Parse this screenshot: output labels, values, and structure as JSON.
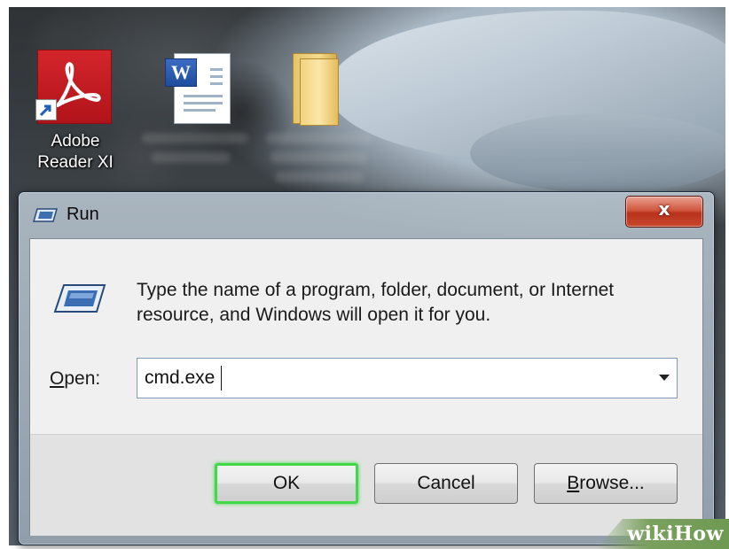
{
  "desktop": {
    "icons": [
      {
        "label": "Adobe\nReader XI"
      }
    ]
  },
  "run_dialog": {
    "title": "Run",
    "close_glyph": "x",
    "prompt": "Type the name of a program, folder, document, or Internet resource, and Windows will open it for you.",
    "open_label_accel": "O",
    "open_label_rest": "pen:",
    "open_value": "cmd.exe",
    "buttons": {
      "ok": "OK",
      "cancel": "Cancel",
      "browse_accel": "B",
      "browse_rest": "rowse..."
    },
    "colors": {
      "ok_highlight": "#43d84a",
      "close_button": "#c9472d"
    }
  },
  "watermark": "wikiHow",
  "icons": {
    "adobe": "adobe-reader-icon",
    "word": "word-document-icon",
    "folder": "folder-icon",
    "run": "run-window-icon",
    "dropdown": "chevron-down-icon",
    "close": "close-icon"
  }
}
